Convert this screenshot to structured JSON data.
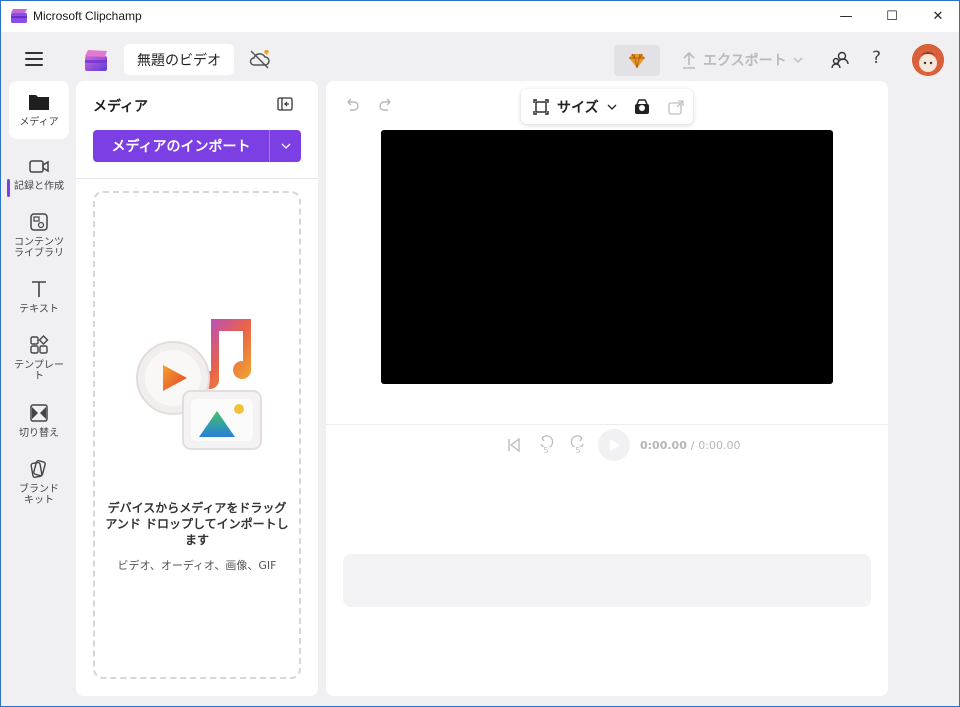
{
  "window": {
    "title": "Microsoft Clipchamp",
    "minimize": "—",
    "maximize": "☐",
    "close": "✕"
  },
  "header": {
    "project_title": "無題のビデオ",
    "export_label": "エクスポート",
    "help_label": "?"
  },
  "rail": {
    "items": [
      {
        "label": "メディア",
        "icon": "folder-icon"
      },
      {
        "label": "記録と作成",
        "icon": "camera-icon"
      },
      {
        "label": "コンテンツ\nライブラリ",
        "icon": "library-icon"
      },
      {
        "label": "テキスト",
        "icon": "text-icon"
      },
      {
        "label": "テンプレー\nト",
        "icon": "templates-icon"
      },
      {
        "label": "切り替え",
        "icon": "transition-icon"
      },
      {
        "label": "ブランド\nキット",
        "icon": "brand-kit-icon"
      }
    ]
  },
  "media": {
    "title": "メディア",
    "import_label": "メディアのインポート",
    "drop_text": "デバイスからメディアをドラッグ アンド ドロップしてインポートします",
    "drop_sub": "ビデオ、オーディオ、画像、GIF"
  },
  "preview": {
    "size_label": "サイズ",
    "time_current": "0:00.00",
    "time_separator": "/",
    "time_total": "0:00.00",
    "skip_seconds_back": "5",
    "skip_seconds_fwd": "5"
  },
  "colors": {
    "accent": "#7b3fe4",
    "background": "#f0f0f3",
    "panel": "#ffffff"
  }
}
